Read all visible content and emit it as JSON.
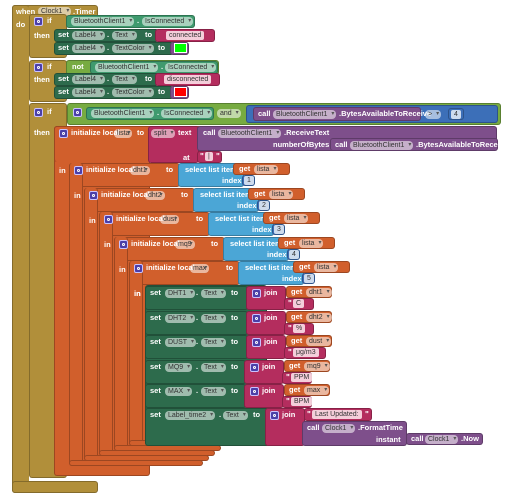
{
  "labels": {
    "when": "when",
    "do": "do",
    "if": "if",
    "then": "then",
    "set": "set",
    "to": "to",
    "dot": ".",
    "not": "not",
    "and": "and",
    "call": "call",
    "get": "get",
    "in": "in",
    "init": "initialize local",
    "select": "select list item  list",
    "index": "index",
    "join": "join",
    "split": "split",
    "text": "text",
    "at": "at",
    "numberOfBytes": "numberOfBytes",
    "instant": "instant",
    "quote": "\""
  },
  "event": {
    "component": "Clock1",
    "event": ".Timer"
  },
  "if1": {
    "cond": {
      "component": "BluetoothClient1",
      "property": "IsConnected"
    },
    "set_text": {
      "component": "Label4",
      "property": "Text",
      "value": "connected"
    },
    "set_color": {
      "component": "Label4",
      "property": "TextColor",
      "color": "#00ff00"
    }
  },
  "if2": {
    "cond": {
      "component": "BluetoothClient1",
      "property": "IsConnected"
    },
    "set_text": {
      "component": "Label4",
      "property": "Text",
      "value": "disconnected"
    },
    "set_color": {
      "component": "Label4",
      "property": "TextColor",
      "color": "#ff0000"
    }
  },
  "if3": {
    "cond": {
      "component": "BluetoothClient1",
      "property": "IsConnected",
      "call_component": "BluetoothClient1",
      "method": ".BytesAvailableToReceive",
      "op": ">",
      "value": "4"
    },
    "lista": {
      "name": "lista",
      "receive_component": "BluetoothClient1",
      "receive_method": ".ReceiveText",
      "bytes_component": "BluetoothClient1",
      "bytes_method": ".BytesAvailableToReceive",
      "separator": "|"
    },
    "locals": [
      {
        "name": "dht1",
        "list": "lista",
        "index": "1"
      },
      {
        "name": "dht2",
        "list": "lista",
        "index": "2"
      },
      {
        "name": "dust",
        "list": "lista",
        "index": "3"
      },
      {
        "name": "mq9",
        "list": "lista",
        "index": "4"
      },
      {
        "name": "max",
        "list": "lista",
        "index": "5"
      }
    ],
    "sets": [
      {
        "component": "DHT1",
        "property": "Text",
        "var": "dht1",
        "suffix": "C"
      },
      {
        "component": "DHT2",
        "property": "Text",
        "var": "dht2",
        "suffix": "%"
      },
      {
        "component": "DUST",
        "property": "Text",
        "var": "dust",
        "suffix": "μg/m3"
      },
      {
        "component": "MQ9",
        "property": "Text",
        "var": "mq9",
        "suffix": "PPM"
      },
      {
        "component": "MAX",
        "property": "Text",
        "var": "max",
        "suffix": "BPM"
      }
    ],
    "time": {
      "component": "Label_time2",
      "property": "Text",
      "prefix": "Last Updated:",
      "clock": "Clock1",
      "format_method": ".FormatTime",
      "now_clock": "Clock1",
      "now_method": ".Now"
    }
  }
}
